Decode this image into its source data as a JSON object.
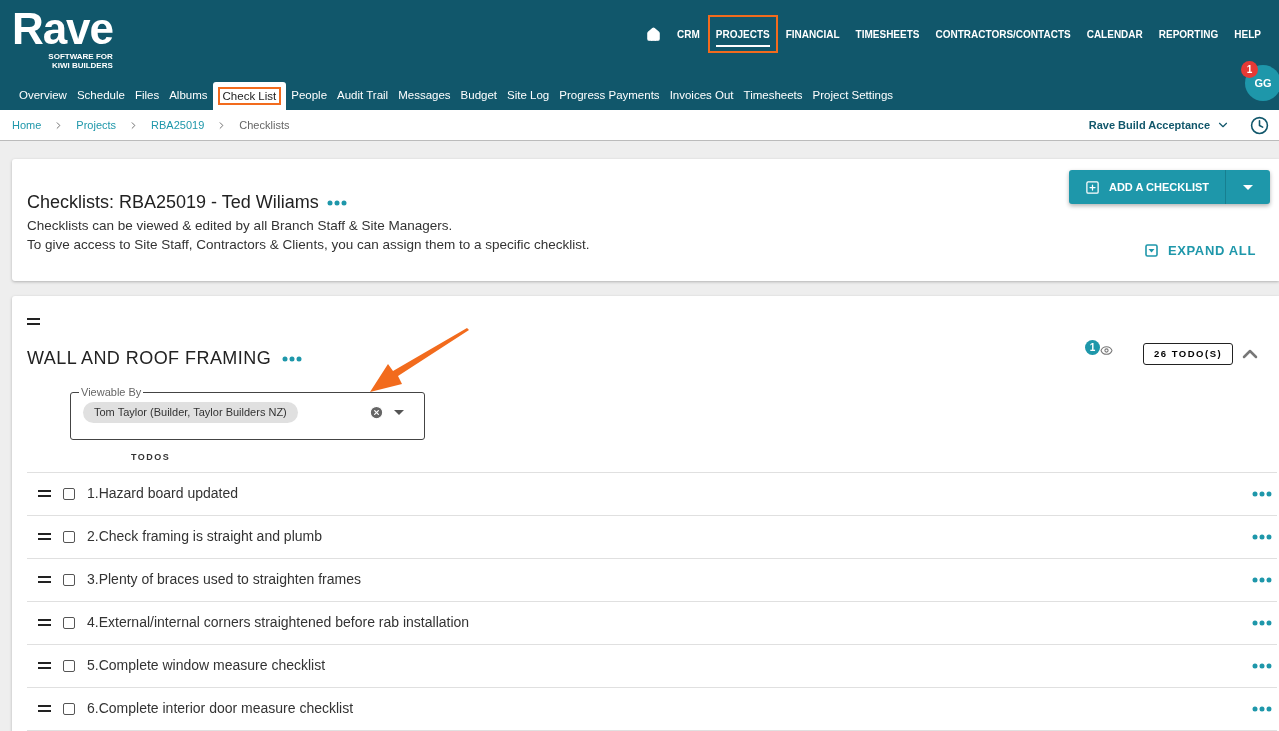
{
  "logo": {
    "name": "Rave",
    "tagline": "SOFTWARE FOR KIWI BUILDERS"
  },
  "main_nav": [
    {
      "label": "CRM",
      "selected": false,
      "highlighted": false
    },
    {
      "label": "PROJECTS",
      "selected": true,
      "highlighted": true
    },
    {
      "label": "FINANCIAL",
      "selected": false,
      "highlighted": false
    },
    {
      "label": "TIMESHEETS",
      "selected": false,
      "highlighted": false
    },
    {
      "label": "CONTRACTORS/CONTACTS",
      "selected": false,
      "highlighted": false
    },
    {
      "label": "CALENDAR",
      "selected": false,
      "highlighted": false
    },
    {
      "label": "REPORTING",
      "selected": false,
      "highlighted": false
    },
    {
      "label": "HELP",
      "selected": false,
      "highlighted": false
    }
  ],
  "user": {
    "initials": "GG",
    "notifications": "1"
  },
  "sub_nav": [
    {
      "label": "Overview",
      "selected": false,
      "highlighted": false
    },
    {
      "label": "Schedule",
      "selected": false,
      "highlighted": false
    },
    {
      "label": "Files",
      "selected": false,
      "highlighted": false
    },
    {
      "label": "Albums",
      "selected": false,
      "highlighted": false
    },
    {
      "label": "Check List",
      "selected": true,
      "highlighted": true
    },
    {
      "label": "People",
      "selected": false,
      "highlighted": false
    },
    {
      "label": "Audit Trail",
      "selected": false,
      "highlighted": false
    },
    {
      "label": "Messages",
      "selected": false,
      "highlighted": false
    },
    {
      "label": "Budget",
      "selected": false,
      "highlighted": false
    },
    {
      "label": "Site Log",
      "selected": false,
      "highlighted": false
    },
    {
      "label": "Progress Payments",
      "selected": false,
      "highlighted": false
    },
    {
      "label": "Invoices Out",
      "selected": false,
      "highlighted": false
    },
    {
      "label": "Timesheets",
      "selected": false,
      "highlighted": false
    },
    {
      "label": "Project Settings",
      "selected": false,
      "highlighted": false
    }
  ],
  "breadcrumbs": [
    "Home",
    "Projects",
    "RBA25019",
    "Checklists"
  ],
  "company_selector": "Rave Build Acceptance",
  "header_card": {
    "title": "Checklists: RBA25019 - Ted Wiliams",
    "description": [
      "Checklists can be viewed & edited by all Branch Staff & Site Managers.",
      "To give access to Site Staff, Contractors & Clients, you can assign them to a specific checklist."
    ],
    "add_button": "ADD A CHECKLIST",
    "expand_all": "EXPAND ALL"
  },
  "checklist": {
    "title": "WALL AND ROOF FRAMING",
    "watchers": "1",
    "todo_count": "26 TODO(S)",
    "expanded": true,
    "viewable_by": {
      "label": "Viewable By",
      "chips": [
        "Tom Taylor (Builder, Taylor Builders NZ)"
      ]
    },
    "todos_heading": "TODOS",
    "todos": [
      {
        "text": "1.Hazard board updated",
        "checked": false
      },
      {
        "text": "2.Check framing is straight and plumb",
        "checked": false
      },
      {
        "text": "3.Plenty of braces used to straighten frames",
        "checked": false
      },
      {
        "text": "4.External/internal corners straightened before rab installation",
        "checked": false
      },
      {
        "text": "5.Complete window measure checklist",
        "checked": false
      },
      {
        "text": "6.Complete interior door measure checklist",
        "checked": false
      }
    ]
  },
  "annotation_arrow": true
}
